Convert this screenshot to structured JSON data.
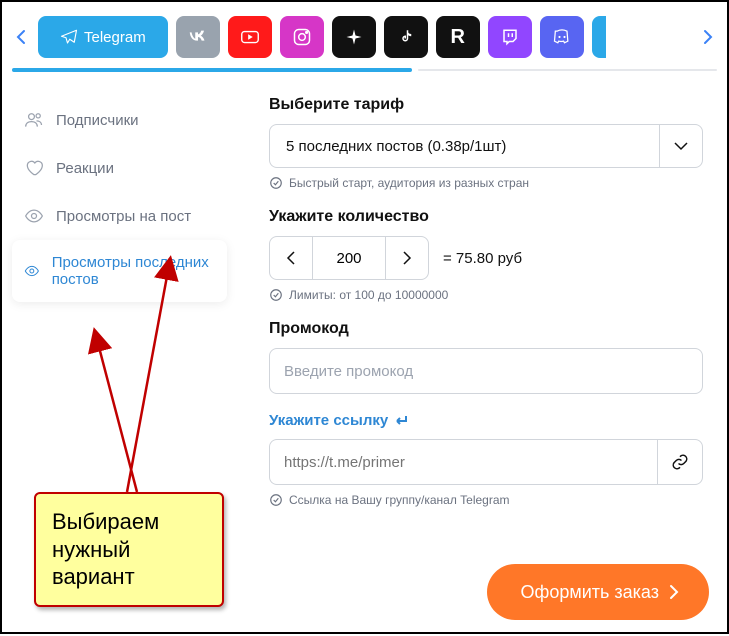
{
  "platforms": {
    "telegram": "Telegram"
  },
  "sidebar": {
    "items": [
      {
        "label": "Подписчики"
      },
      {
        "label": "Реакции"
      },
      {
        "label": "Просмотры на пост"
      },
      {
        "label": "Просмотры последних постов"
      }
    ]
  },
  "form": {
    "tariff_label": "Выберите тариф",
    "tariff_value": "5 последних постов (0.38р/1шт)",
    "tariff_hint": "Быстрый старт, аудитория из разных стран",
    "qty_label": "Укажите количество",
    "qty_value": "200",
    "qty_price": "= 75.80 руб",
    "qty_hint": "Лимиты: от 100 до 10000000",
    "promo_label": "Промокод",
    "promo_placeholder": "Введите промокод",
    "link_label": "Укажите ссылку",
    "link_placeholder": "https://t.me/primer",
    "link_hint": "Ссылка на Вашу группу/канал Telegram",
    "order_button": "Оформить заказ"
  },
  "annotation": {
    "text": "Выбираем нужный вариант"
  }
}
